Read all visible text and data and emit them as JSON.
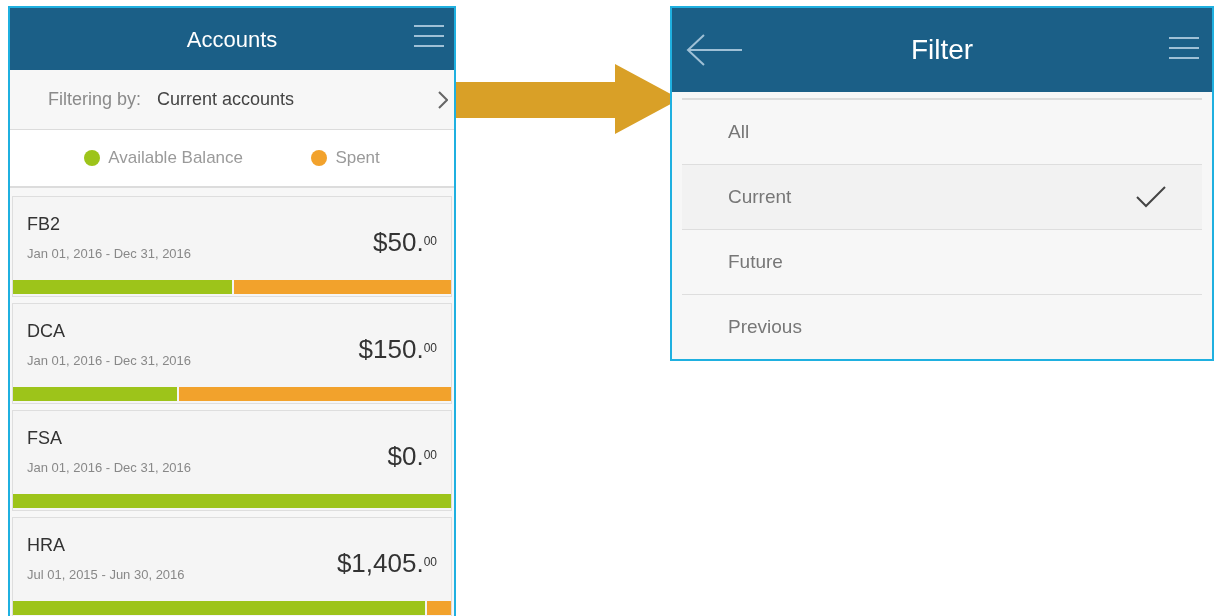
{
  "accounts_screen": {
    "title": "Accounts",
    "filter": {
      "label": "Filtering by:",
      "value": "Current accounts"
    },
    "legend": [
      {
        "label": "Available Balance",
        "color": "#9dc41a"
      },
      {
        "label": "Spent",
        "color": "#f2a22c"
      }
    ],
    "accounts": [
      {
        "name": "FB2",
        "period": "Jan 01, 2016 - Dec 31, 2016",
        "amount": "$50.$^{00}$",
        "level": 0.5
      },
      {
        "name": "DCA",
        "period": "Jan 01, 2016 - Dec 31, 2016",
        "amount": "$150.$^{00}$",
        "level": 0.375
      },
      {
        "name": "FSA",
        "period": "Jan 01, 2016 - Dec 31, 2016",
        "amount": "$0.$^{00}$",
        "level": 1
      },
      {
        "name": "HRA",
        "period": "Jul 01, 2015 - Jun 30, 2016",
        "amount": "$1,405.$^{00}$",
        "level": 0.94
      }
    ]
  },
  "filter_screen": {
    "title": "Filter",
    "options": [
      {
        "label": "All",
        "selected": false
      },
      {
        "label": "Current",
        "selected": true
      },
      {
        "label": "Future",
        "selected": false
      },
      {
        "label": "Previous",
        "selected": false
      }
    ]
  }
}
